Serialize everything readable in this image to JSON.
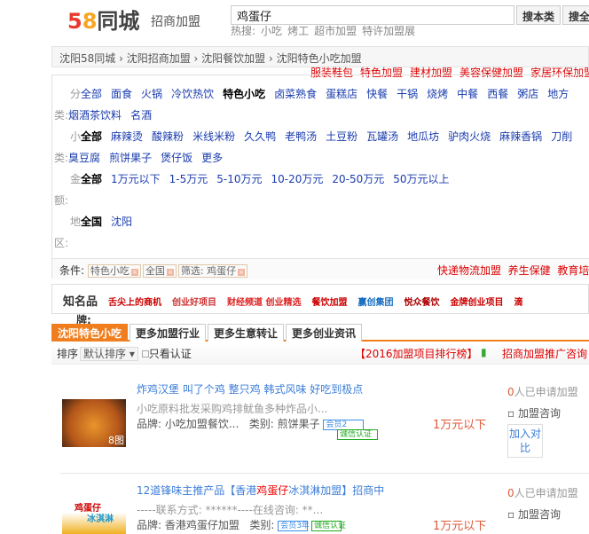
{
  "header": {
    "logo": "58同城",
    "logo_num1": "5",
    "logo_num2": "8",
    "logo_text": "同城",
    "section": "招商加盟",
    "search_value": "鸡蛋仔",
    "btn_search_cat": "搜本类",
    "btn_search_all": "搜全",
    "hot_label": "热搜:",
    "hot": [
      "小吃",
      "烤工",
      "超市加盟",
      "特许加盟展"
    ]
  },
  "breadcrumb": [
    "沈阳58同城",
    "沈阳招商加盟",
    "沈阳餐饮加盟",
    "沈阳特色小吃加盟"
  ],
  "red_links": [
    "服装鞋包",
    "特色加盟",
    "建材加盟",
    "美容保健加盟",
    "家居环保加盟"
  ],
  "filters": {
    "category": {
      "k1": "分",
      "k2": "类:",
      "all": "全部",
      "items": [
        "面食",
        "火锅",
        "冷饮热饮"
      ],
      "selected": "特色小吃",
      "items2": [
        "卤菜熟食",
        "蛋糕店",
        "快餐",
        "干锅",
        "烧烤",
        "中餐",
        "西餐",
        "粥店",
        "地方"
      ],
      "row2": [
        "烟酒茶饮料",
        "名酒"
      ]
    },
    "subcategory": {
      "k1": "小",
      "k2": "类:",
      "all": "全部",
      "items": [
        "麻辣烫",
        "酸辣粉",
        "米线米粉",
        "久久鸭",
        "老鸭汤",
        "土豆粉",
        "瓦罐汤",
        "地瓜坊",
        "驴肉火烧",
        "麻辣香锅",
        "刀削"
      ],
      "row2": [
        "臭豆腐",
        "煎饼果子",
        "煲仔饭",
        "更多"
      ]
    },
    "amount": {
      "k1": "金",
      "k2": "额:",
      "all": "全部",
      "items": [
        "1万元以下",
        "1-5万元",
        "5-10万元",
        "10-20万元",
        "20-50万元",
        "50万元以上"
      ]
    },
    "region": {
      "k1": "地",
      "k2": "区:",
      "all": "全国",
      "items": [
        "沈阳"
      ]
    },
    "conditions": {
      "label": "条件:",
      "tags": [
        "特色小吃",
        "全国",
        "筛选: 鸡蛋仔"
      ],
      "right_links": [
        "快递物流加盟",
        "养生保健",
        "教育培"
      ]
    }
  },
  "brands": {
    "label1": "知名品",
    "label2": "牌:",
    "logos": [
      "舌尖上的商机",
      "创业好项目",
      "财经频道 创业精选",
      "餐饮加盟",
      "赢创集团",
      "悦众餐饮",
      "金牌创业项目",
      "滴"
    ]
  },
  "tabs": [
    "沈阳特色小吃",
    "更多加盟行业",
    "更多生意转让",
    "更多创业资讯"
  ],
  "sort": {
    "label": "排序",
    "value": "默认排序",
    "verified": "只看认证",
    "ranking": "【2016加盟项目排行榜】",
    "consult": "招商加盟推广咨询"
  },
  "listings": [
    {
      "title": "炸鸡汉堡 叫了个鸡 整只鸡 韩式风味 好吃到极点",
      "desc": "小吃原料批发采购鸡排鱿鱼多种炸品小...",
      "brand": "品牌: 小吃加盟餐饮...",
      "category": "类别: 煎饼果子",
      "badge1": "会员2",
      "badge2": "诚信认证",
      "img_count": "8图",
      "price": "1万元以下",
      "applied_count": "0",
      "applied_text": "人已申请加盟",
      "consult": "加盟咨询",
      "compare": "加入对比"
    },
    {
      "title_pre": "12道锋味主推产品【香港",
      "title_hl": "鸡蛋仔",
      "title_post": "冰淇淋加盟】招商中",
      "desc": "-----联系方式: ******----在线咨询: **...",
      "brand": "品牌: 香港鸡蛋仔加盟",
      "category": "类别:",
      "badge1": "会员3年",
      "badge2": "诚信认证",
      "img_label1": "鸡蛋仔",
      "img_label2": "冰淇淋",
      "price": "1万元以下",
      "applied_count": "0",
      "applied_text": "人已申请加盟",
      "consult": "加盟咨询"
    }
  ]
}
